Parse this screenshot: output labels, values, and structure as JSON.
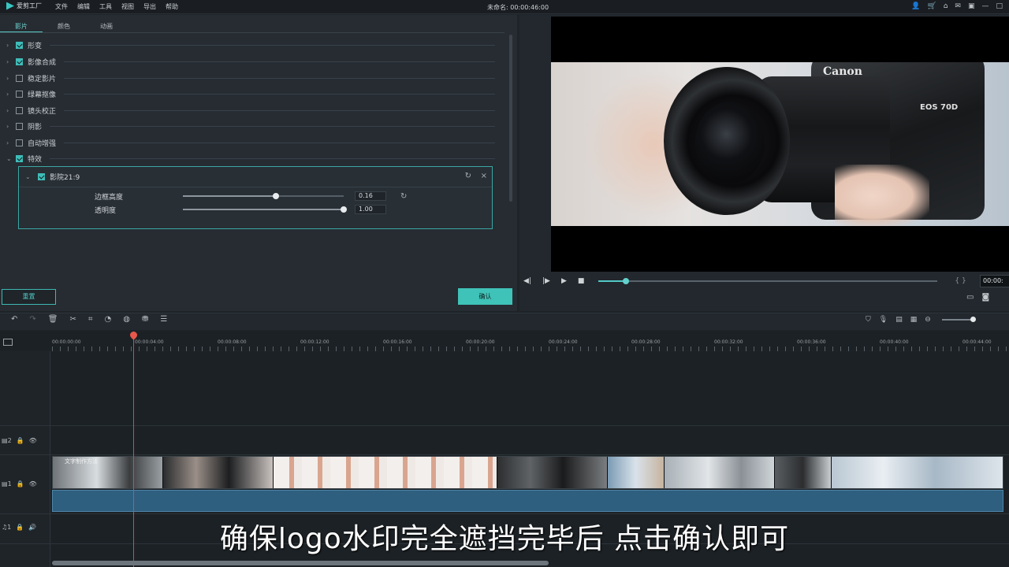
{
  "app": {
    "logo_text": "爱剪工厂",
    "menus": [
      "文件",
      "编辑",
      "工具",
      "视图",
      "导出",
      "帮助"
    ],
    "doc_title": "未命名: 00:00:46:00"
  },
  "tabs": [
    "影片",
    "颜色",
    "动画"
  ],
  "properties": [
    {
      "label": "形变",
      "checked": true
    },
    {
      "label": "影像合成",
      "checked": true
    },
    {
      "label": "稳定影片",
      "checked": false
    },
    {
      "label": "绿幕抠像",
      "checked": false
    },
    {
      "label": "镜头校正",
      "checked": false
    },
    {
      "label": "阴影",
      "checked": false
    },
    {
      "label": "自动增强",
      "checked": false
    },
    {
      "label": "特效",
      "checked": true
    }
  ],
  "effect": {
    "name": "影院21:9",
    "params": [
      {
        "label": "边框高度",
        "value": "0.16",
        "level": 0.58
      },
      {
        "label": "透明度",
        "value": "1.00",
        "level": 1.0
      }
    ]
  },
  "buttons": {
    "reset": "重置",
    "ok": "确认"
  },
  "preview": {
    "brand": "Canon",
    "model": "EOS 70D",
    "timecode": "00:00:",
    "progress": 0.08
  },
  "ruler": [
    "00:00:00:00",
    "00:00:04:00",
    "00:00:08:00",
    "00:00:12:00",
    "00:00:16:00",
    "00:00:20:00",
    "00:00:24:00",
    "00:00:28:00",
    "00:00:32:00",
    "00:00:36:00",
    "00:00:40:00",
    "00:00:44:00"
  ],
  "tracks": {
    "track2": "2",
    "track1": "1",
    "audio": "1"
  },
  "clip_label": "文字制作方法",
  "subtitle": "确保logo水印完全遮挡完毕后  点击确认即可",
  "colors": {
    "accent": "#3fc2b7",
    "playhead": "#e0473e",
    "audio": "#2f5f7f"
  }
}
